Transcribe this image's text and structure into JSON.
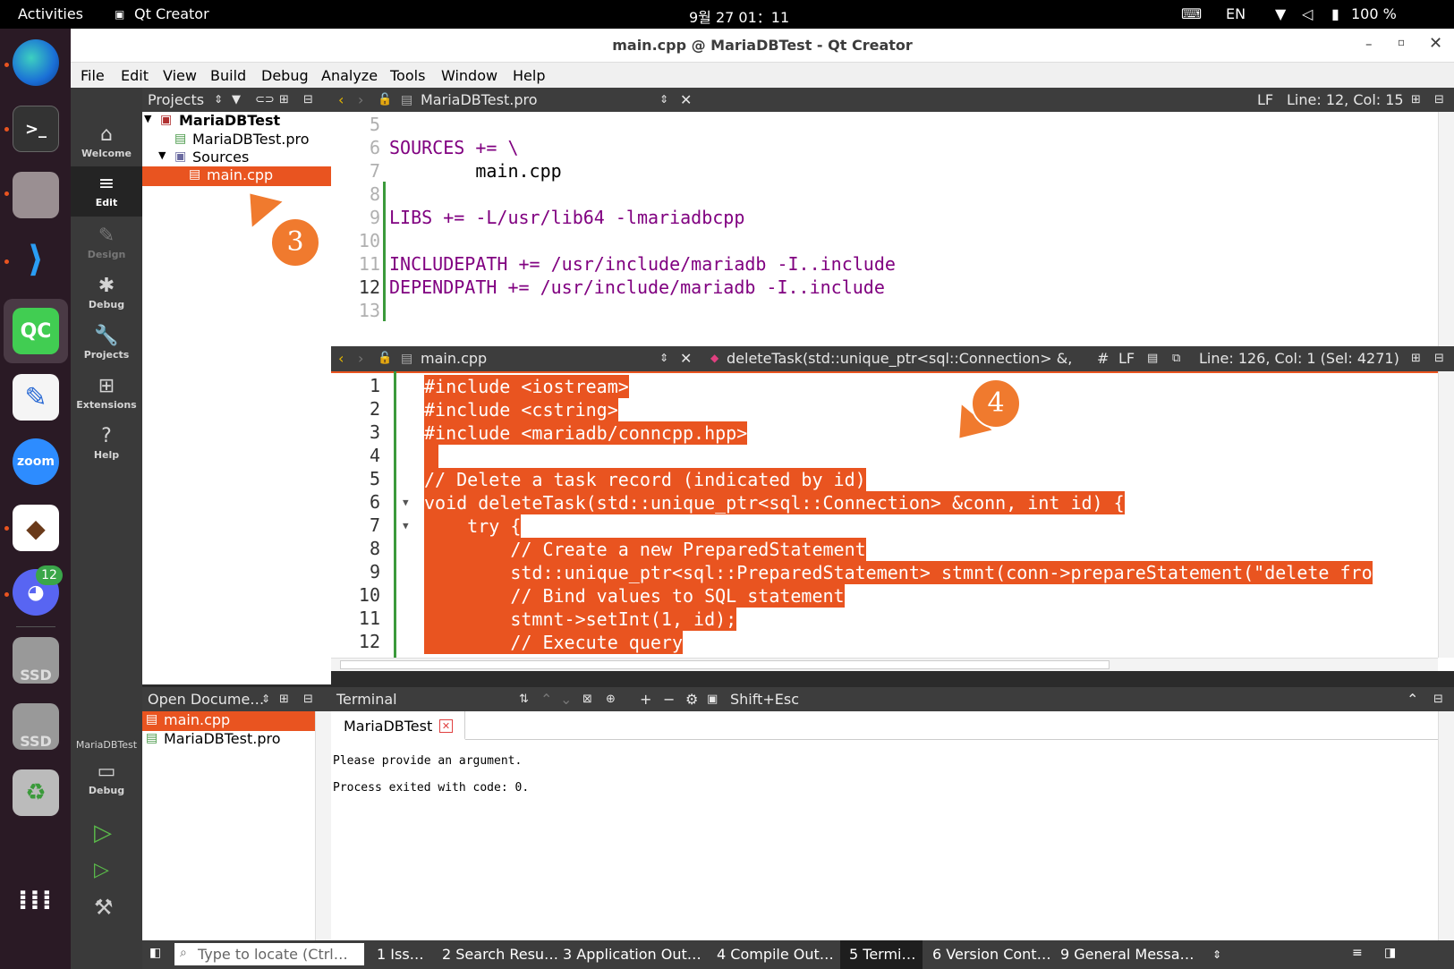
{
  "topbar": {
    "activities": "Activities",
    "app": "Qt Creator",
    "clock": "9월 27  01：11",
    "lang": "EN",
    "battery": "100 %"
  },
  "dock": {
    "discord_badge": "12",
    "ssd1": "SSD",
    "ssd2": "SSD",
    "zoom": "zoom",
    "qt": "QC"
  },
  "window": {
    "title": "main.cpp @ MariaDBTest - Qt Creator"
  },
  "menu": [
    "File",
    "Edit",
    "View",
    "Build",
    "Debug",
    "Analyze",
    "Tools",
    "Window",
    "Help"
  ],
  "modes": [
    {
      "label": "Welcome",
      "icon": "⌂"
    },
    {
      "label": "Edit",
      "icon": "≡"
    },
    {
      "label": "Design",
      "icon": "✎"
    },
    {
      "label": "Debug",
      "icon": "✱"
    },
    {
      "label": "Projects",
      "icon": "🔧"
    },
    {
      "label": "Extensions",
      "icon": "⊞"
    },
    {
      "label": "Help",
      "icon": "?"
    }
  ],
  "kit": {
    "project": "MariaDBTest",
    "mode": "Debug"
  },
  "projects": {
    "header": "Projects",
    "tree": [
      "MariaDBTest",
      "MariaDBTest.pro",
      "Sources",
      "main.cpp"
    ]
  },
  "editor_top": {
    "file": "MariaDBTest.pro",
    "status_lf": "LF",
    "status_pos": "Line: 12, Col: 15",
    "line_numbers": [
      "5",
      "6",
      "7",
      "8",
      "9",
      "10",
      "11",
      "12",
      "13"
    ],
    "lines": [
      "",
      "SOURCES += \\",
      "        main.cpp",
      "",
      "LIBS += -L/usr/lib64 -lmariadbcpp",
      "",
      "INCLUDEPATH += /usr/include/mariadb -I..include",
      "DEPENDPATH += /usr/include/mariadb -I..include",
      ""
    ]
  },
  "editor_bottom": {
    "file": "main.cpp",
    "symbol": "deleteTask(std::unique_ptr<sql::Connection> &, int…",
    "hash": "#",
    "status_lf": "LF",
    "status_pos": "Line: 126, Col: 1 (Sel: 4271)",
    "line_numbers": [
      "1",
      "2",
      "3",
      "4",
      "5",
      "6",
      "7",
      "8",
      "9",
      "10",
      "11",
      "12"
    ],
    "lines": [
      "#include <iostream>",
      "#include <cstring>",
      "#include <mariadb/conncpp.hpp>",
      " ",
      "// Delete a task record (indicated by id)",
      "void deleteTask(std::unique_ptr<sql::Connection> &conn, int id) {",
      "    try {",
      "        // Create a new PreparedStatement",
      "        std::unique_ptr<sql::PreparedStatement> stmnt(conn->prepareStatement(\"delete fro",
      "        // Bind values to SQL statement",
      "        stmnt->setInt(1, id);",
      "        // Execute query"
    ]
  },
  "open_docs": {
    "header": "Open Docume…",
    "items": [
      "main.cpp",
      "MariaDBTest.pro"
    ]
  },
  "terminal": {
    "header": "Terminal",
    "shortcut": "Shift+Esc",
    "tab": "MariaDBTest",
    "output": [
      "Please provide an argument.",
      "Process exited with code: 0."
    ]
  },
  "statusbar": {
    "locate_placeholder": "Type to locate (Ctrl…",
    "tabs": [
      "1  Iss…",
      "2  Search Resu…",
      "3  Application Out…",
      "4  Compile Out…",
      "5  Termi…",
      "6  Version Cont…",
      "9  General Messa…"
    ]
  },
  "callouts": [
    "3",
    "4"
  ]
}
